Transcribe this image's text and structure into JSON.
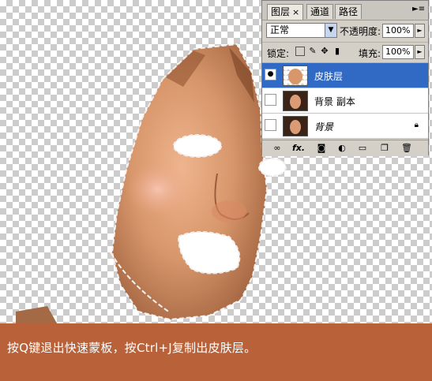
{
  "caption": {
    "text": "按Q键退出快速蒙板，按Ctrl+J复制出皮肤层。"
  },
  "colors": {
    "caption_bg": "#b9623a",
    "selection_blue": "#316ac5"
  },
  "layers_panel": {
    "tabs": [
      {
        "label": "图层",
        "active": true,
        "close": "×"
      },
      {
        "label": "通道",
        "active": false
      },
      {
        "label": "路径",
        "active": false
      }
    ],
    "menu_icon": "panel-menu-icon",
    "blend_mode": "正常",
    "opacity_label": "不透明度:",
    "opacity_value": "100%",
    "lock_label": "锁定:",
    "lock_icons": [
      "lock-transparent-icon",
      "lock-paint-icon",
      "lock-move-icon",
      "lock-all-icon"
    ],
    "fill_label": "填充:",
    "fill_value": "100%",
    "layers": [
      {
        "name": "皮肤层",
        "visible": true,
        "selected": true,
        "locked": false
      },
      {
        "name": "背景 副本",
        "visible": false,
        "selected": false,
        "locked": false
      },
      {
        "name": "背景",
        "visible": false,
        "selected": false,
        "locked": true,
        "italic": true
      }
    ],
    "bottom_icons": [
      "link-layers-icon",
      "fx-icon",
      "add-mask-icon",
      "adjustment-layer-icon",
      "new-group-icon",
      "new-layer-icon",
      "delete-layer-icon"
    ],
    "fx_label": "fx."
  }
}
